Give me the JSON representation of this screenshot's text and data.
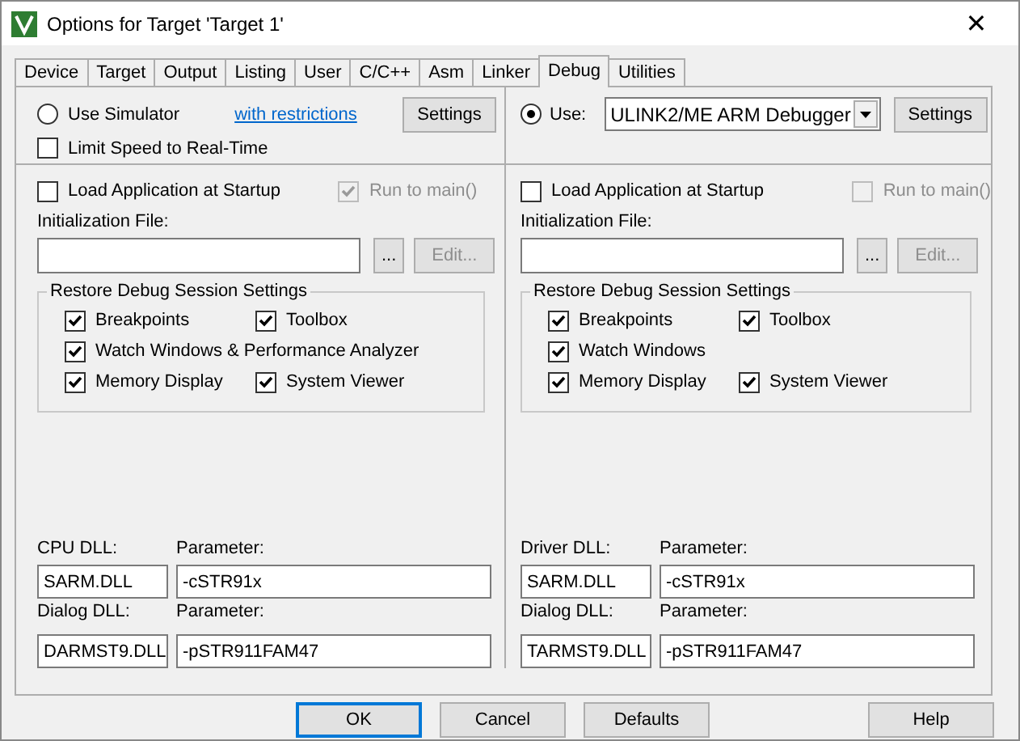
{
  "window": {
    "title": "Options for Target 'Target 1'",
    "close": "✕"
  },
  "tabs": [
    {
      "label": "Device",
      "selected": false
    },
    {
      "label": "Target",
      "selected": false
    },
    {
      "label": "Output",
      "selected": false
    },
    {
      "label": "Listing",
      "selected": false
    },
    {
      "label": "User",
      "selected": false
    },
    {
      "label": "C/C++",
      "selected": false
    },
    {
      "label": "Asm",
      "selected": false
    },
    {
      "label": "Linker",
      "selected": false
    },
    {
      "label": "Debug",
      "selected": true
    },
    {
      "label": "Utilities",
      "selected": false
    }
  ],
  "panes": [
    {
      "mode": {
        "kind": "simulator",
        "label": "Use Simulator",
        "selected": false,
        "link": "with restrictions"
      },
      "settings": "Settings",
      "limit_speed": {
        "label": "Limit Speed to Real-Time",
        "checked": false
      },
      "load_app": {
        "label": "Load Application at Startup",
        "checked": false
      },
      "run_to_main": {
        "label": "Run to main()",
        "checked": true,
        "disabled": true
      },
      "init_file": {
        "label": "Initialization File:",
        "browse": "...",
        "edit": "Edit...",
        "edit_disabled": true
      },
      "restore": {
        "title": "Restore Debug Session Settings",
        "options": [
          {
            "label": "Breakpoints",
            "checked": true
          },
          {
            "label": "Toolbox",
            "checked": true
          },
          {
            "label": "Watch Windows & Performance Analyzer",
            "checked": true
          },
          {
            "label": "Memory Display",
            "checked": true
          },
          {
            "label": "System Viewer",
            "checked": true
          }
        ]
      },
      "dlls": [
        {
          "label": "CPU DLL:",
          "value": "SARM.DLL",
          "param_label": "Parameter:",
          "param_value": "-cSTR91x"
        },
        {
          "label": "Dialog DLL:",
          "value": "DARMST9.DLL",
          "param_label": "Parameter:",
          "param_value": "-pSTR911FAM47"
        }
      ]
    },
    {
      "mode": {
        "kind": "target",
        "label": "Use:",
        "selected": true,
        "value": "ULINK2/ME ARM Debugger"
      },
      "settings": "Settings",
      "load_app": {
        "label": "Load Application at Startup",
        "checked": false
      },
      "run_to_main": {
        "label": "Run to main()",
        "checked": false,
        "disabled": true
      },
      "init_file": {
        "label": "Initialization File:",
        "browse": "...",
        "edit": "Edit...",
        "edit_disabled": true
      },
      "restore": {
        "title": "Restore Debug Session Settings",
        "options": [
          {
            "label": "Breakpoints",
            "checked": true
          },
          {
            "label": "Toolbox",
            "checked": true
          },
          {
            "label": "Watch Windows",
            "checked": true
          },
          {
            "label": "Memory Display",
            "checked": true
          },
          {
            "label": "System Viewer",
            "checked": true
          }
        ]
      },
      "dlls": [
        {
          "label": "Driver DLL:",
          "value": "SARM.DLL",
          "param_label": "Parameter:",
          "param_value": "-cSTR91x"
        },
        {
          "label": "Dialog DLL:",
          "value": "TARMST9.DLL",
          "param_label": "Parameter:",
          "param_value": "-pSTR911FAM47"
        }
      ]
    }
  ],
  "buttons": [
    {
      "label": "OK",
      "default": true
    },
    {
      "label": "Cancel",
      "default": false
    },
    {
      "label": "Defaults",
      "default": false
    },
    {
      "label": "Help",
      "default": false
    }
  ]
}
